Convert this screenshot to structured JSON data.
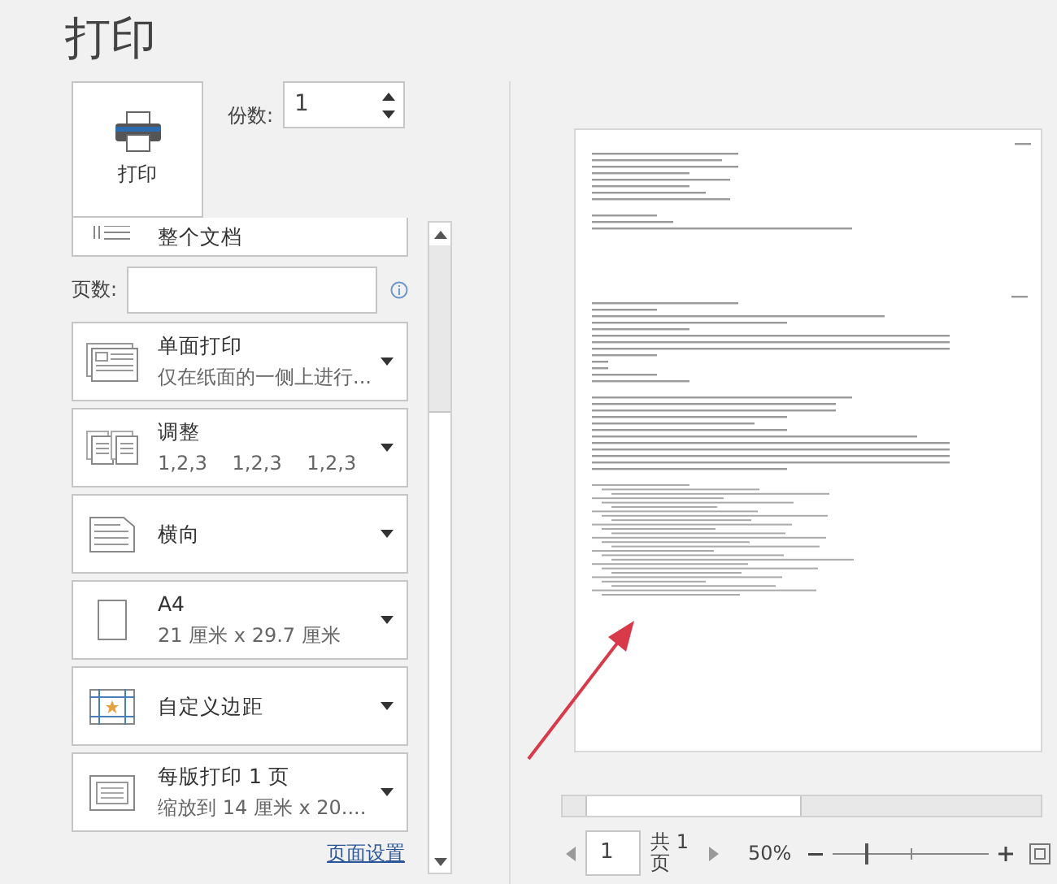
{
  "title": "打印",
  "print_button": {
    "label": "打印"
  },
  "copies": {
    "label": "份数:",
    "value": "1"
  },
  "settings": [
    {
      "kind": "scope",
      "title": "整个文档"
    },
    {
      "kind": "pages",
      "label": "页数:"
    },
    {
      "kind": "sides",
      "title": "单面打印",
      "subtitle": "仅在纸面的一侧上进行..."
    },
    {
      "kind": "collate",
      "title": "调整",
      "subtitle": "1,2,3    1,2,3    1,2,3"
    },
    {
      "kind": "orientation",
      "title": "横向"
    },
    {
      "kind": "paper",
      "title": "A4",
      "subtitle": "21 厘米 x 29.7 厘米"
    },
    {
      "kind": "margins",
      "title": "自定义边距"
    },
    {
      "kind": "per_sheet",
      "title": "每版打印 1 页",
      "subtitle": "缩放到 14 厘米 x 20...."
    }
  ],
  "page_setup_link": "页面设置",
  "preview": {
    "page": "1",
    "total": "共 1 页",
    "zoom": "50%",
    "zoom_slider": {
      "level": 0.22
    }
  }
}
